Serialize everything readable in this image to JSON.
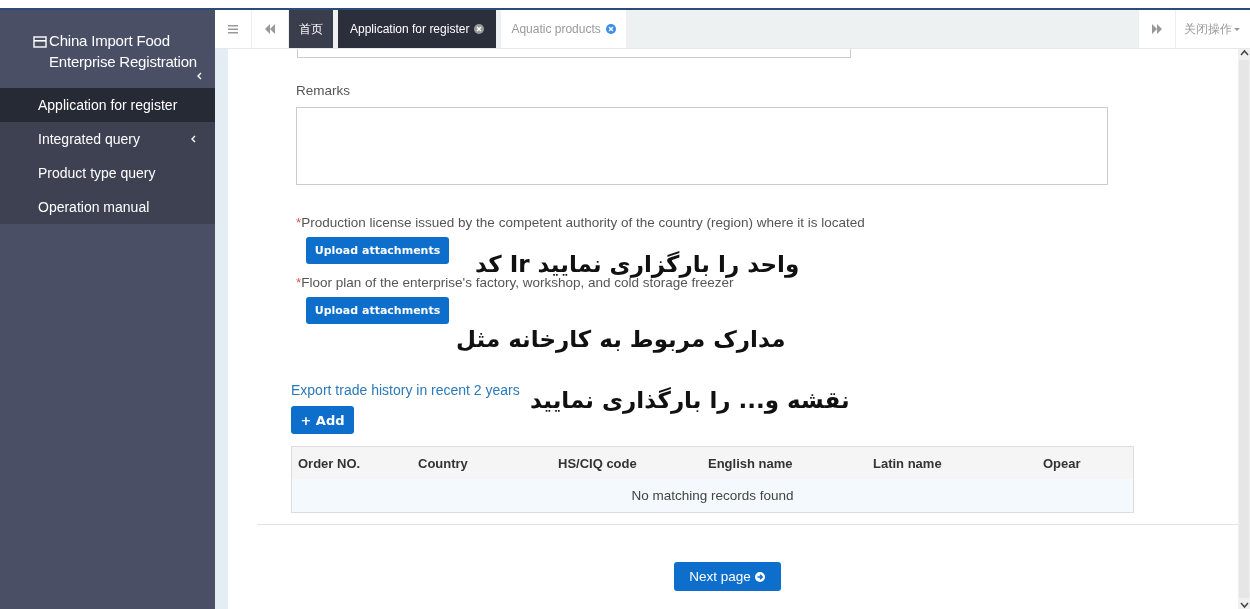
{
  "sidebar": {
    "title": "China Import Food Enterprise Registration",
    "items": [
      {
        "label": "Application for register",
        "selected": true,
        "has_submenu": false
      },
      {
        "label": "Integrated query",
        "selected": false,
        "has_submenu": true
      },
      {
        "label": "Product type query",
        "selected": false,
        "has_submenu": false
      },
      {
        "label": "Operation manual",
        "selected": false,
        "has_submenu": false
      }
    ]
  },
  "tabs": [
    {
      "label": "首页",
      "selected": false,
      "closable": false
    },
    {
      "label": "Application for register",
      "selected": true,
      "closable": true
    },
    {
      "label": "Aquatic products",
      "selected": false,
      "closable": true
    }
  ],
  "close_menu": "关闭操作",
  "form": {
    "remarks_label": "Remarks",
    "uploads": [
      {
        "marker": "*",
        "label": "Production license issued by the competent authority of the country (region) where it is located",
        "button": "Upload attachments"
      },
      {
        "marker": "*",
        "label": "Floor plan of the enterprise's factory, workshop, and cold storage freezer",
        "button": "Upload attachments"
      }
    ],
    "history_title": "Export trade history in recent 2 years",
    "add_button": "+ Add",
    "table": {
      "columns": [
        "Order NO.",
        "Country",
        "HS/CIQ code",
        "English name",
        "Latin name",
        "Opear"
      ],
      "empty_text": "No matching records found"
    },
    "next_button": "Next page"
  },
  "annotations": [
    "واحد را بارگزاری نمایید Ir کد",
    "مدارک مربوط به کارخانه مثل",
    "نقشه و... را بارگذاری نمایید"
  ]
}
